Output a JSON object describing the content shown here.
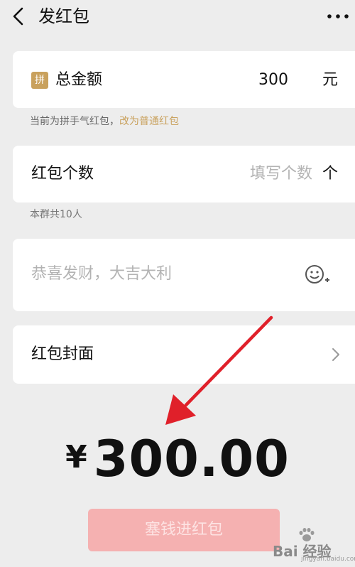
{
  "header": {
    "title": "发红包",
    "back_icon": "chevron-left-icon",
    "more_icon": "more-dots-icon"
  },
  "amount_card": {
    "badge": "拼",
    "label": "总金额",
    "value": "300",
    "unit": "元"
  },
  "mode_hint": {
    "text": "当前为拼手气红包，",
    "link": "改为普通红包"
  },
  "count_card": {
    "label": "红包个数",
    "placeholder": "填写个数",
    "unit": "个"
  },
  "group_hint": "本群共10人",
  "message_card": {
    "placeholder": "恭喜发财，大吉大利",
    "emoji_icon": "emoji-add-icon"
  },
  "cover_card": {
    "label": "红包封面",
    "chevron_icon": "chevron-right-icon"
  },
  "total": {
    "currency": "¥",
    "amount": "300.00"
  },
  "submit_button": {
    "label": "塞钱进红包"
  },
  "watermark": {
    "text": "Bai 经验",
    "sub": "jingyan.baidu.com"
  },
  "colors": {
    "background": "#ededed",
    "accent_gold": "#c9a15d",
    "button_disabled": "#f5b1b1",
    "annotation_arrow": "#e0202a"
  }
}
